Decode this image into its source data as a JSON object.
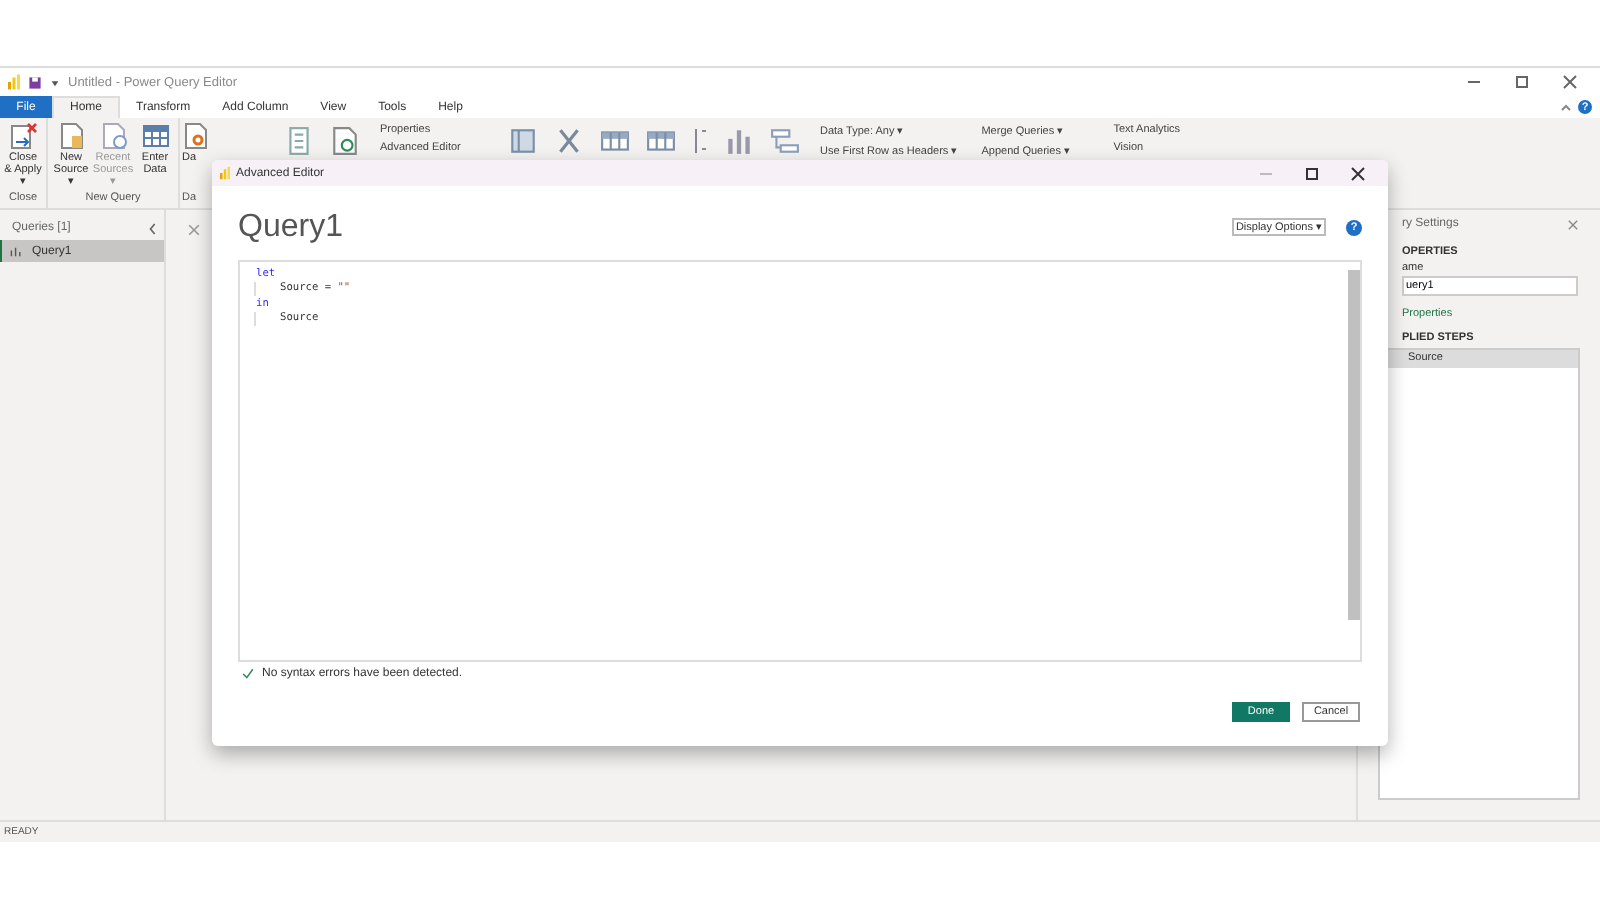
{
  "window": {
    "title": "Untitled - Power Query Editor"
  },
  "tabs": [
    {
      "label": "File",
      "selected": false,
      "kind": "file"
    },
    {
      "label": "Home",
      "selected": true,
      "kind": "tab"
    },
    {
      "label": "Transform",
      "selected": false,
      "kind": "tab"
    },
    {
      "label": "Add Column",
      "selected": false,
      "kind": "tab"
    },
    {
      "label": "View",
      "selected": false,
      "kind": "tab"
    },
    {
      "label": "Tools",
      "selected": false,
      "kind": "tab"
    },
    {
      "label": "Help",
      "selected": false,
      "kind": "tab"
    }
  ],
  "help": "?",
  "ribbon": {
    "groups": [
      {
        "label": "Close",
        "buttons": [
          {
            "label": "Close & Apply ▾",
            "disabled": false
          }
        ]
      },
      {
        "label": "New Query",
        "buttons": [
          {
            "label": "New Source ▾",
            "disabled": false
          },
          {
            "label": "Recent Sources ▾",
            "disabled": true
          },
          {
            "label": "Enter Data",
            "disabled": false
          }
        ]
      },
      {
        "label": "Da",
        "buttons": [
          {
            "label": "Da",
            "disabled": false
          }
        ]
      }
    ],
    "small_button_columns": [
      {
        "buttons": [
          "Properties",
          "Advanced Editor"
        ]
      },
      {
        "buttons": [
          "Data Type: Any ▾",
          "Use First Row as Headers ▾"
        ]
      },
      {
        "buttons": [
          "Merge Queries ▾",
          "Append Queries ▾"
        ]
      },
      {
        "buttons": [
          "Text Analytics",
          "Vision"
        ]
      }
    ]
  },
  "queries": {
    "title": "Queries [1]",
    "items": [
      {
        "name": "Query1",
        "selected": true
      }
    ]
  },
  "query_settings": {
    "title": "ry Settings",
    "properties_heading": "OPERTIES",
    "name_label": "ame",
    "name_value": "uery1",
    "properties_link": "Properties",
    "steps_heading": "PLIED STEPS",
    "steps": [
      {
        "name": "Source",
        "selected": true
      }
    ]
  },
  "status_bar": "READY",
  "dialog": {
    "title": "Advanced Editor",
    "help": "?",
    "query_name": "Query1",
    "display_options": "Display Options ▾",
    "code_lines": [
      {
        "tokens": [
          {
            "text": "let",
            "kind": "keyword"
          }
        ],
        "children": [
          {
            "tokens": [
              {
                "text": "Source = ",
                "kind": "plain"
              },
              {
                "text": "\"\"",
                "kind": "string"
              }
            ]
          }
        ]
      },
      {
        "tokens": [
          {
            "text": "in",
            "kind": "keyword"
          }
        ],
        "children": [
          {
            "tokens": [
              {
                "text": "Source",
                "kind": "plain"
              }
            ]
          }
        ]
      }
    ],
    "syntax_message": "No syntax errors have been detected.",
    "buttons": [
      {
        "label": "Done",
        "kind": "primary"
      },
      {
        "label": "Cancel",
        "kind": "secondary"
      }
    ]
  }
}
